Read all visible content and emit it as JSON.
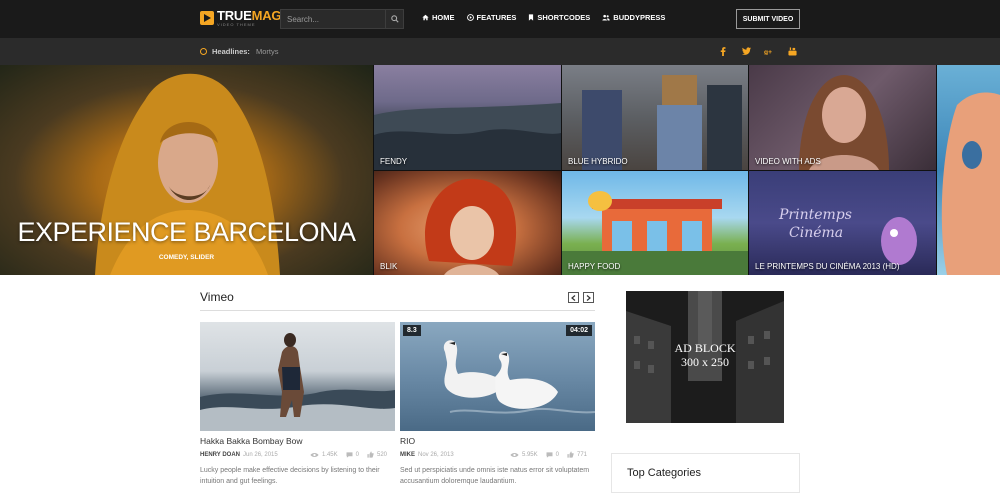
{
  "brand": {
    "name_part1": "TRUE",
    "name_part2": "MAG",
    "tagline": "VIDEO THEME"
  },
  "search": {
    "placeholder": "Search..."
  },
  "nav": [
    {
      "label": "HOME",
      "icon": "home-icon"
    },
    {
      "label": "FEATURES",
      "icon": "circle-play-icon"
    },
    {
      "label": "SHORTCODES",
      "icon": "bookmark-icon"
    },
    {
      "label": "BUDDYPRESS",
      "icon": "users-icon"
    }
  ],
  "submit_button": "SUBMIT VIDEO",
  "headlines": {
    "label": "Headlines:",
    "value": "Mortys"
  },
  "socials": [
    "facebook-icon",
    "twitter-icon",
    "google-plus-icon",
    "youtube-icon"
  ],
  "hero": {
    "main": {
      "title": "EXPERIENCE BARCELONA",
      "categories": "COMEDY, SLIDER"
    },
    "tiles": [
      {
        "label": "FENDY"
      },
      {
        "label": "BLUE HYBRIDO"
      },
      {
        "label": "VIDEO WITH ADS"
      },
      {
        "label": "BLIK"
      },
      {
        "label": "HAPPY FOOD"
      },
      {
        "label": "LE PRINTEMPS DU CINÉMA 2013 (HD)"
      }
    ]
  },
  "vimeo": {
    "title": "Vimeo",
    "cards": [
      {
        "title": "Hakka Bakka Bombay Bow",
        "author": "HENRY DOAN",
        "date": "Jun 26, 2015",
        "views": "1.45K",
        "comments": "0",
        "likes": "520",
        "description": "Lucky people make effective decisions by listening to their intuition and gut feelings."
      },
      {
        "title": "RIO",
        "author": "MIKE",
        "date": "Nov 26, 2013",
        "views": "5.95K",
        "comments": "0",
        "likes": "771",
        "rating": "8.3",
        "duration": "04:02",
        "description": "Sed ut perspiciatis unde omnis iste natus error sit voluptatem accusantium doloremque laudantium."
      }
    ]
  },
  "sidebar": {
    "ad": {
      "line1": "AD BLOCK",
      "line2": "300 x 250"
    },
    "top_categories_title": "Top Categories"
  },
  "colors": {
    "accent": "#f5a623",
    "topbar": "#1a1a1a",
    "headbar": "#2b2b2b"
  }
}
